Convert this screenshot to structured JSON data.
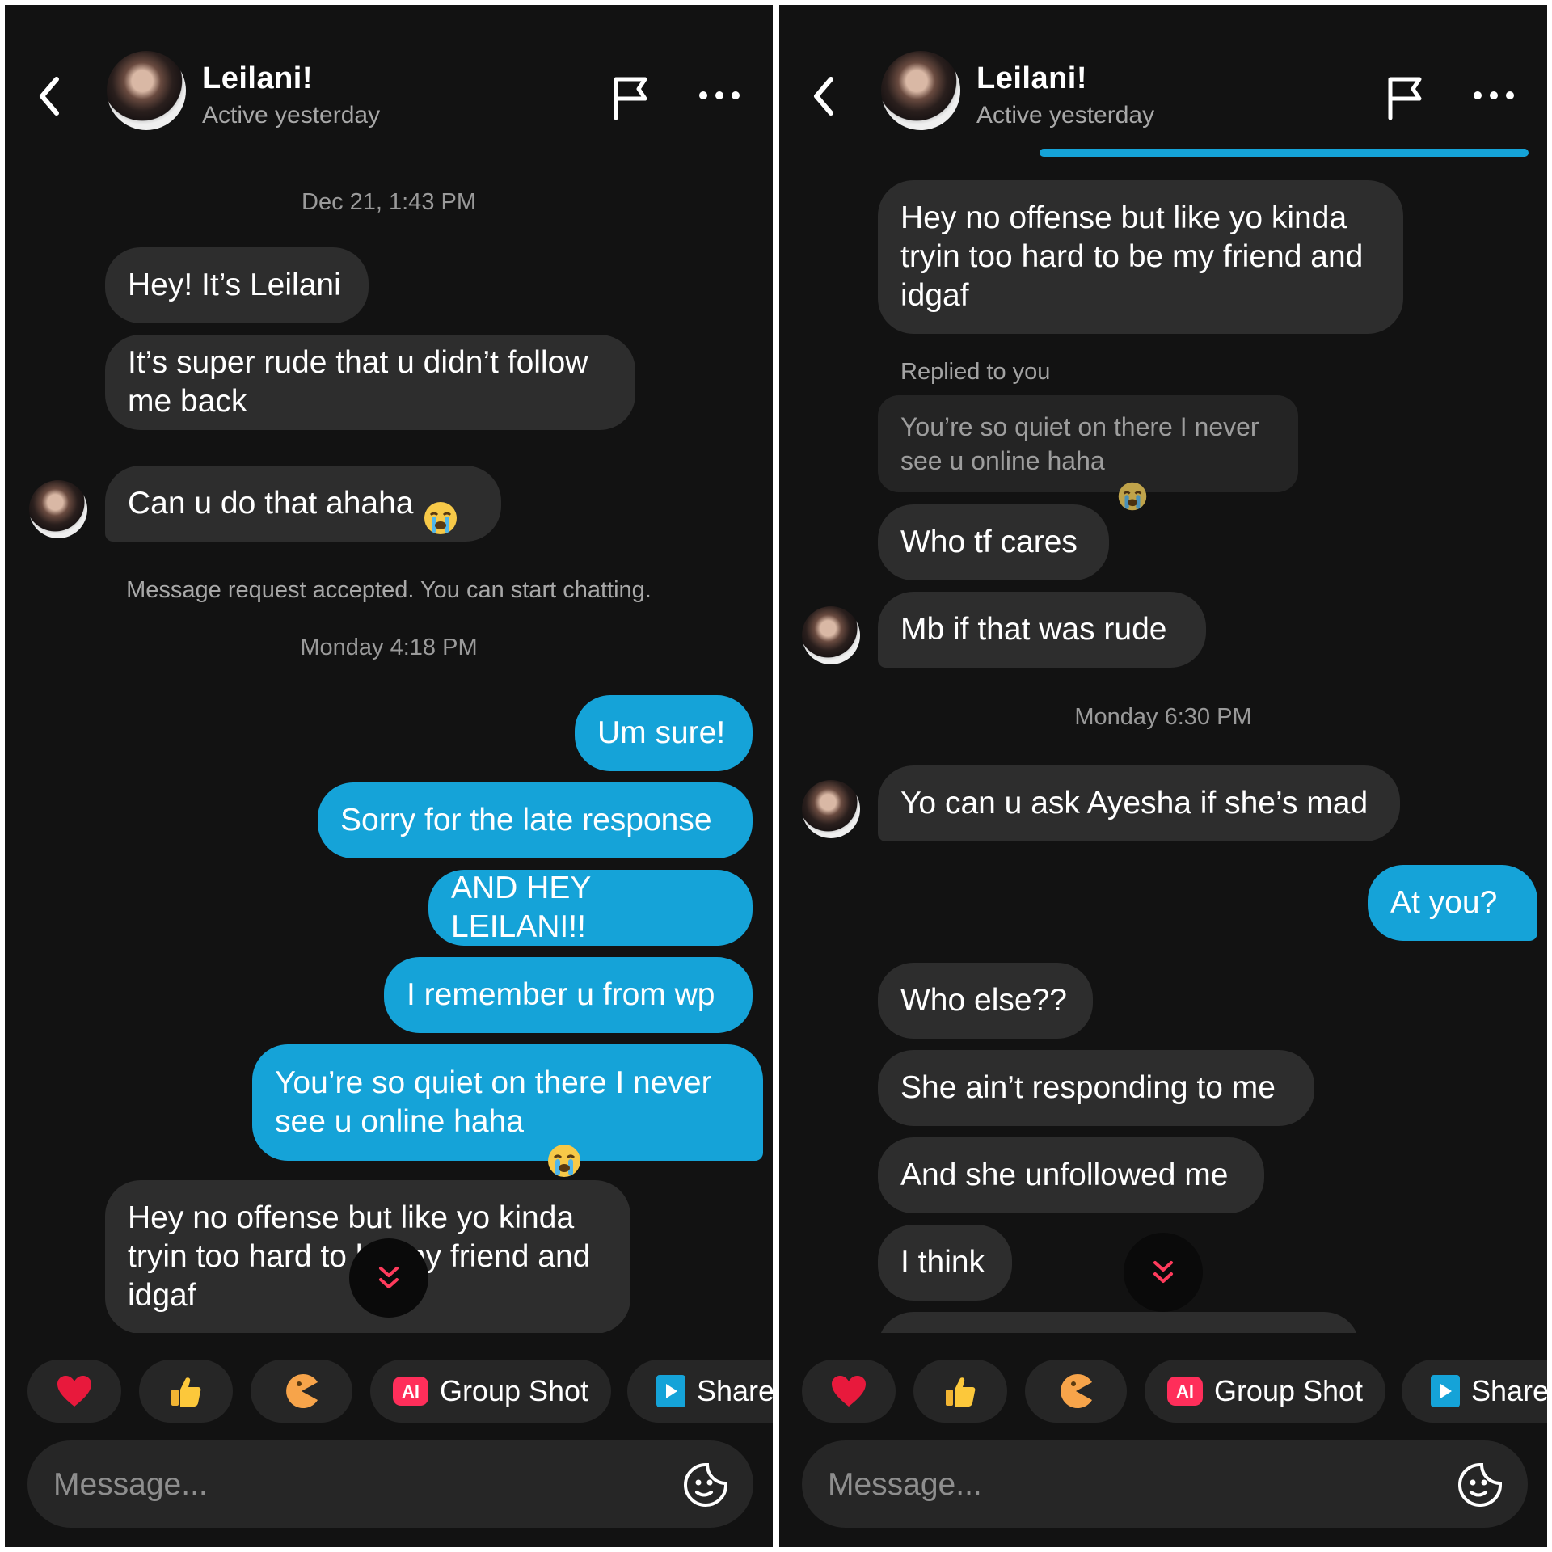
{
  "contact": {
    "name": "Leilani!",
    "status": "Active yesterday"
  },
  "composer": {
    "placeholder": "Message..."
  },
  "quick_actions": [
    {
      "type": "emoji",
      "icon": "heart-icon"
    },
    {
      "type": "emoji",
      "icon": "thumbs-up-icon"
    },
    {
      "type": "emoji",
      "icon": "pacman-face-icon"
    },
    {
      "type": "chip",
      "icon": "ai-badge-icon",
      "badge": "AI",
      "label": "Group Shot"
    },
    {
      "type": "chip",
      "icon": "share-play-icon",
      "label": "Share"
    }
  ],
  "left": {
    "timestamp_1": "Dec 21, 1:43 PM",
    "msg_1": "Hey! It’s Leilani",
    "msg_2": "It’s super rude that u didn’t follow\nme back",
    "msg_3": "Can u do that ahaha",
    "system_note": "Message request accepted. You can start chatting.",
    "timestamp_2": "Monday 4:18 PM",
    "out_1": "Um sure!",
    "out_2": "Sorry for the late response",
    "out_3": "AND HEY LEILANI!!",
    "out_4": "I remember u from wp",
    "out_5": "You’re so quiet on there I never\nsee u online haha",
    "msg_4": "Hey no offense but like yo kinda\ntryin too hard to be my friend and\nidgaf"
  },
  "right": {
    "msg_1": "Hey no offense but like yo kinda\ntryin too hard to be my friend and\nidgaf",
    "replied_label": "Replied to you",
    "quoted": "You’re so quiet on there I never\nsee u online haha",
    "msg_2": "Who tf cares",
    "msg_3": "Mb if that was rude",
    "timestamp_1": "Monday 6:30 PM",
    "msg_4": "Yo can u ask Ayesha if she’s mad",
    "out_1": "At you?",
    "msg_5": "Who else??",
    "msg_6": "She ain’t responding to me",
    "msg_7": "And she unfollowed me",
    "msg_8": "I think"
  },
  "colors": {
    "background": "#121212",
    "incoming_bubble": "#2d2d2d",
    "outgoing_bubble": "#15a3d8",
    "secondary_text": "#a8a8a8",
    "scroll_button_chevron": "#ff3b5c"
  }
}
